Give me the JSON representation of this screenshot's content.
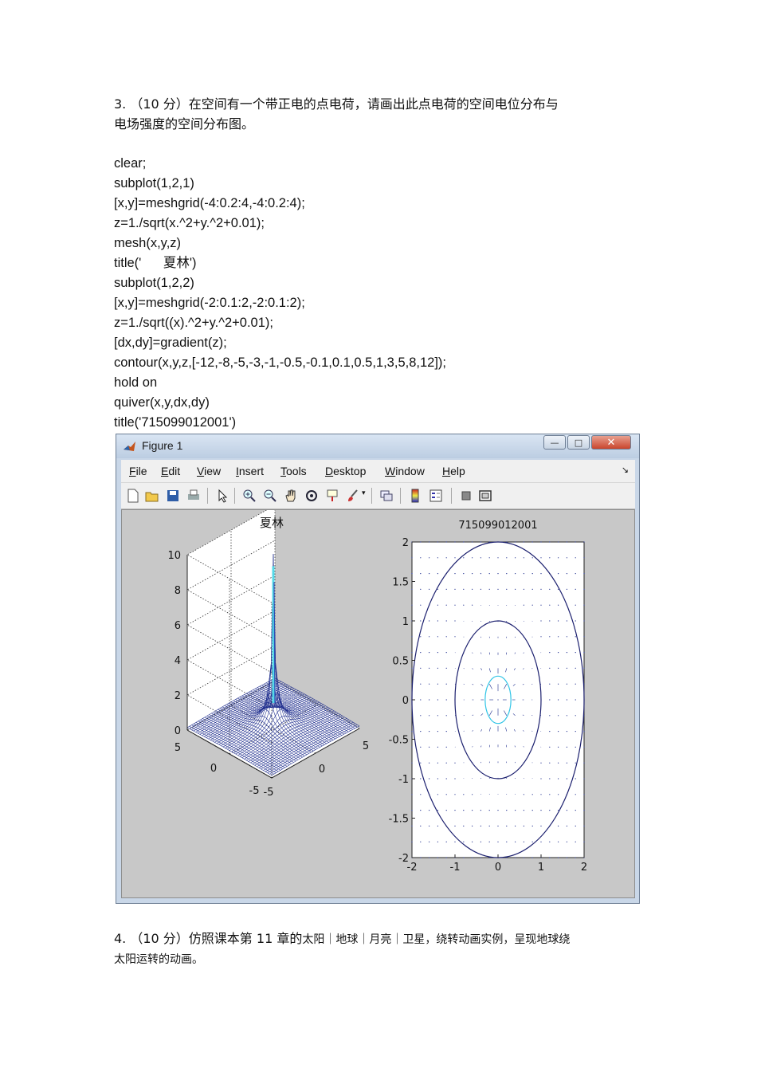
{
  "question3": {
    "line1": "3. （10 分）在空间有一个带正电的点电荷，请画出此点电荷的空间电位分布与",
    "line2": "电场强度的空间分布图。"
  },
  "code_lines": [
    "clear;",
    "subplot(1,2,1)",
    "[x,y]=meshgrid(-4:0.2:4,-4:0.2:4);",
    "z=1./sqrt(x.^2+y.^2+0.01);",
    "mesh(x,y,z)",
    "title('      夏林')",
    "subplot(1,2,2)",
    "[x,y]=meshgrid(-2:0.1:2,-2:0.1:2);",
    "z=1./sqrt((x).^2+y.^2+0.01);",
    "[dx,dy]=gradient(z);",
    "contour(x,y,z,[-12,-8,-5,-3,-1,-0.5,-0.1,0.1,0.5,1,3,5,8,12]);",
    "hold on",
    "quiver(x,y,dx,dy)",
    "title('715099012001')"
  ],
  "figure": {
    "window_title": "Figure 1",
    "menu": [
      "File",
      "Edit",
      "View",
      "Insert",
      "Tools",
      "Desktop",
      "Window",
      "Help"
    ],
    "menu_arrow": "↘",
    "toolbar_icons": [
      "new-figure-icon",
      "open-file-icon",
      "save-icon",
      "print-icon",
      "edit-plot-arrow-icon",
      "zoom-in-icon",
      "zoom-out-icon",
      "pan-hand-icon",
      "rotate-3d-icon",
      "data-cursor-icon",
      "brush-icon",
      "link-plot-icon",
      "colorbar-icon",
      "legend-icon",
      "hide-plot-tools-icon",
      "show-plot-tools-icon"
    ],
    "close_label": "✕",
    "max_label": "□",
    "min_label": "—"
  },
  "chart_data": [
    {
      "type": "mesh3d",
      "title": "夏林",
      "function": "z = 1/sqrt(x^2 + y^2 + 0.01)",
      "xlim": [
        -5,
        5
      ],
      "ylim": [
        -5,
        5
      ],
      "zlim": [
        0,
        10
      ],
      "z_ticks": [
        "0",
        "2",
        "4",
        "6",
        "8",
        "10"
      ],
      "x_ticks": [
        "-5",
        "0",
        "5"
      ],
      "y_ticks": [
        "-5",
        "0",
        "5"
      ],
      "peak_value": 10,
      "grid": true,
      "colors": {
        "mesh": "#1b2a8c",
        "peak": "#55d8e8"
      }
    },
    {
      "type": "contour_quiver",
      "title": "715099012001",
      "xlim": [
        -2,
        2
      ],
      "ylim": [
        -2,
        2
      ],
      "x_ticks": [
        "-2",
        "-1",
        "0",
        "1",
        "2"
      ],
      "y_ticks": [
        "2",
        "1.5",
        "1",
        "0.5",
        "0",
        "-0.5",
        "-1",
        "-1.5",
        "-2"
      ],
      "contour_levels": [
        -12,
        -8,
        -5,
        -3,
        -1,
        -0.5,
        -0.1,
        0.1,
        0.5,
        1,
        3,
        5,
        8,
        12
      ],
      "visible_contour_radii": [
        2,
        1,
        0.3
      ],
      "colors": {
        "outer": "#1b1f6e",
        "inner": "#2ec4e6",
        "arrows": "#1b2a8c"
      }
    }
  ],
  "question4": {
    "line1_a": "4. （10 分）仿照课本第  11 章的",
    "line1_b": "太阳｜地球｜月亮｜卫星，绕转动画实例，呈现地球绕",
    "line2": "太阳运转的动画。"
  }
}
